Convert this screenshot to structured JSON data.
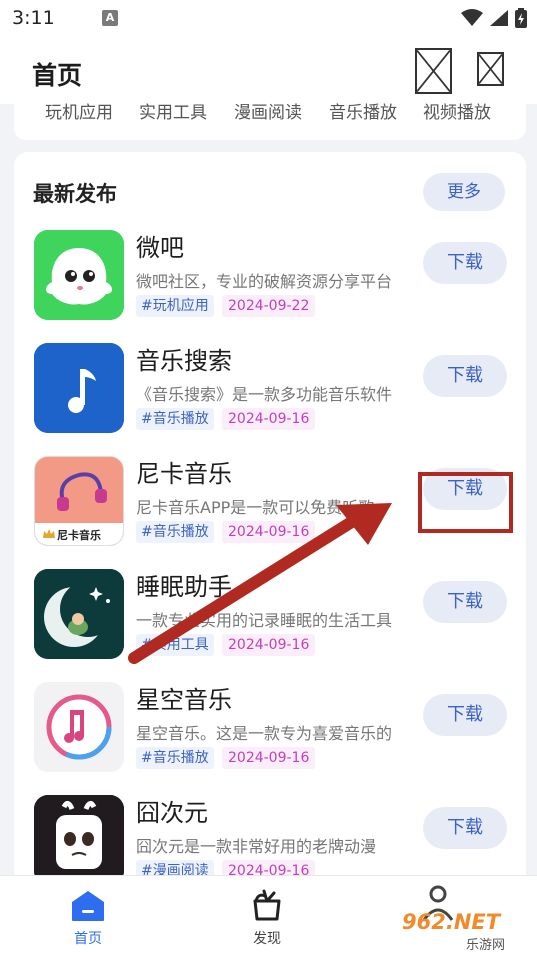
{
  "status_bar": {
    "time": "3:11",
    "notif_icon": "A"
  },
  "header": {
    "title": "首页"
  },
  "categories": [
    "玩机应用",
    "实用工具",
    "漫画阅读",
    "音乐播放",
    "视频播放"
  ],
  "section": {
    "title": "最新发布",
    "more_label": "更多"
  },
  "apps": [
    {
      "name": "微吧",
      "desc": "微吧社区，专业的破解资源分享平台",
      "tag": "#玩机应用",
      "date": "2024-09-22",
      "button": "下载"
    },
    {
      "name": "音乐搜索",
      "desc": "《音乐搜索》是一款多功能音乐软件",
      "tag": "#音乐播放",
      "date": "2024-09-16",
      "button": "下载"
    },
    {
      "name": "尼卡音乐",
      "desc": "尼卡音乐APP是一款可以免费听歌",
      "tag": "#音乐播放",
      "date": "2024-09-16",
      "button": "下载",
      "icon_label": "尼卡音乐"
    },
    {
      "name": "睡眠助手",
      "desc": "一款专业实用的记录睡眠的生活工具",
      "tag": "#实用工具",
      "date": "2024-09-16",
      "button": "下载"
    },
    {
      "name": "星空音乐",
      "desc": "星空音乐。这是一款专为喜爱音乐的",
      "tag": "#音乐播放",
      "date": "2024-09-16",
      "button": "下载"
    },
    {
      "name": "囧次元",
      "desc": "囧次元是一款非常好用的老牌动漫",
      "tag": "#漫画阅读",
      "date": "2024-09-16",
      "button": "下载"
    }
  ],
  "bottom_nav": [
    {
      "label": "首页",
      "icon": "home-icon",
      "active": true
    },
    {
      "label": "发现",
      "icon": "discover-icon",
      "active": false
    }
  ],
  "watermark": {
    "brand": "962.NET",
    "site": "乐游网"
  },
  "colors": {
    "accent": "#3b62c4",
    "highlight": "#b02a21",
    "date_tag": "#c23fbb"
  }
}
